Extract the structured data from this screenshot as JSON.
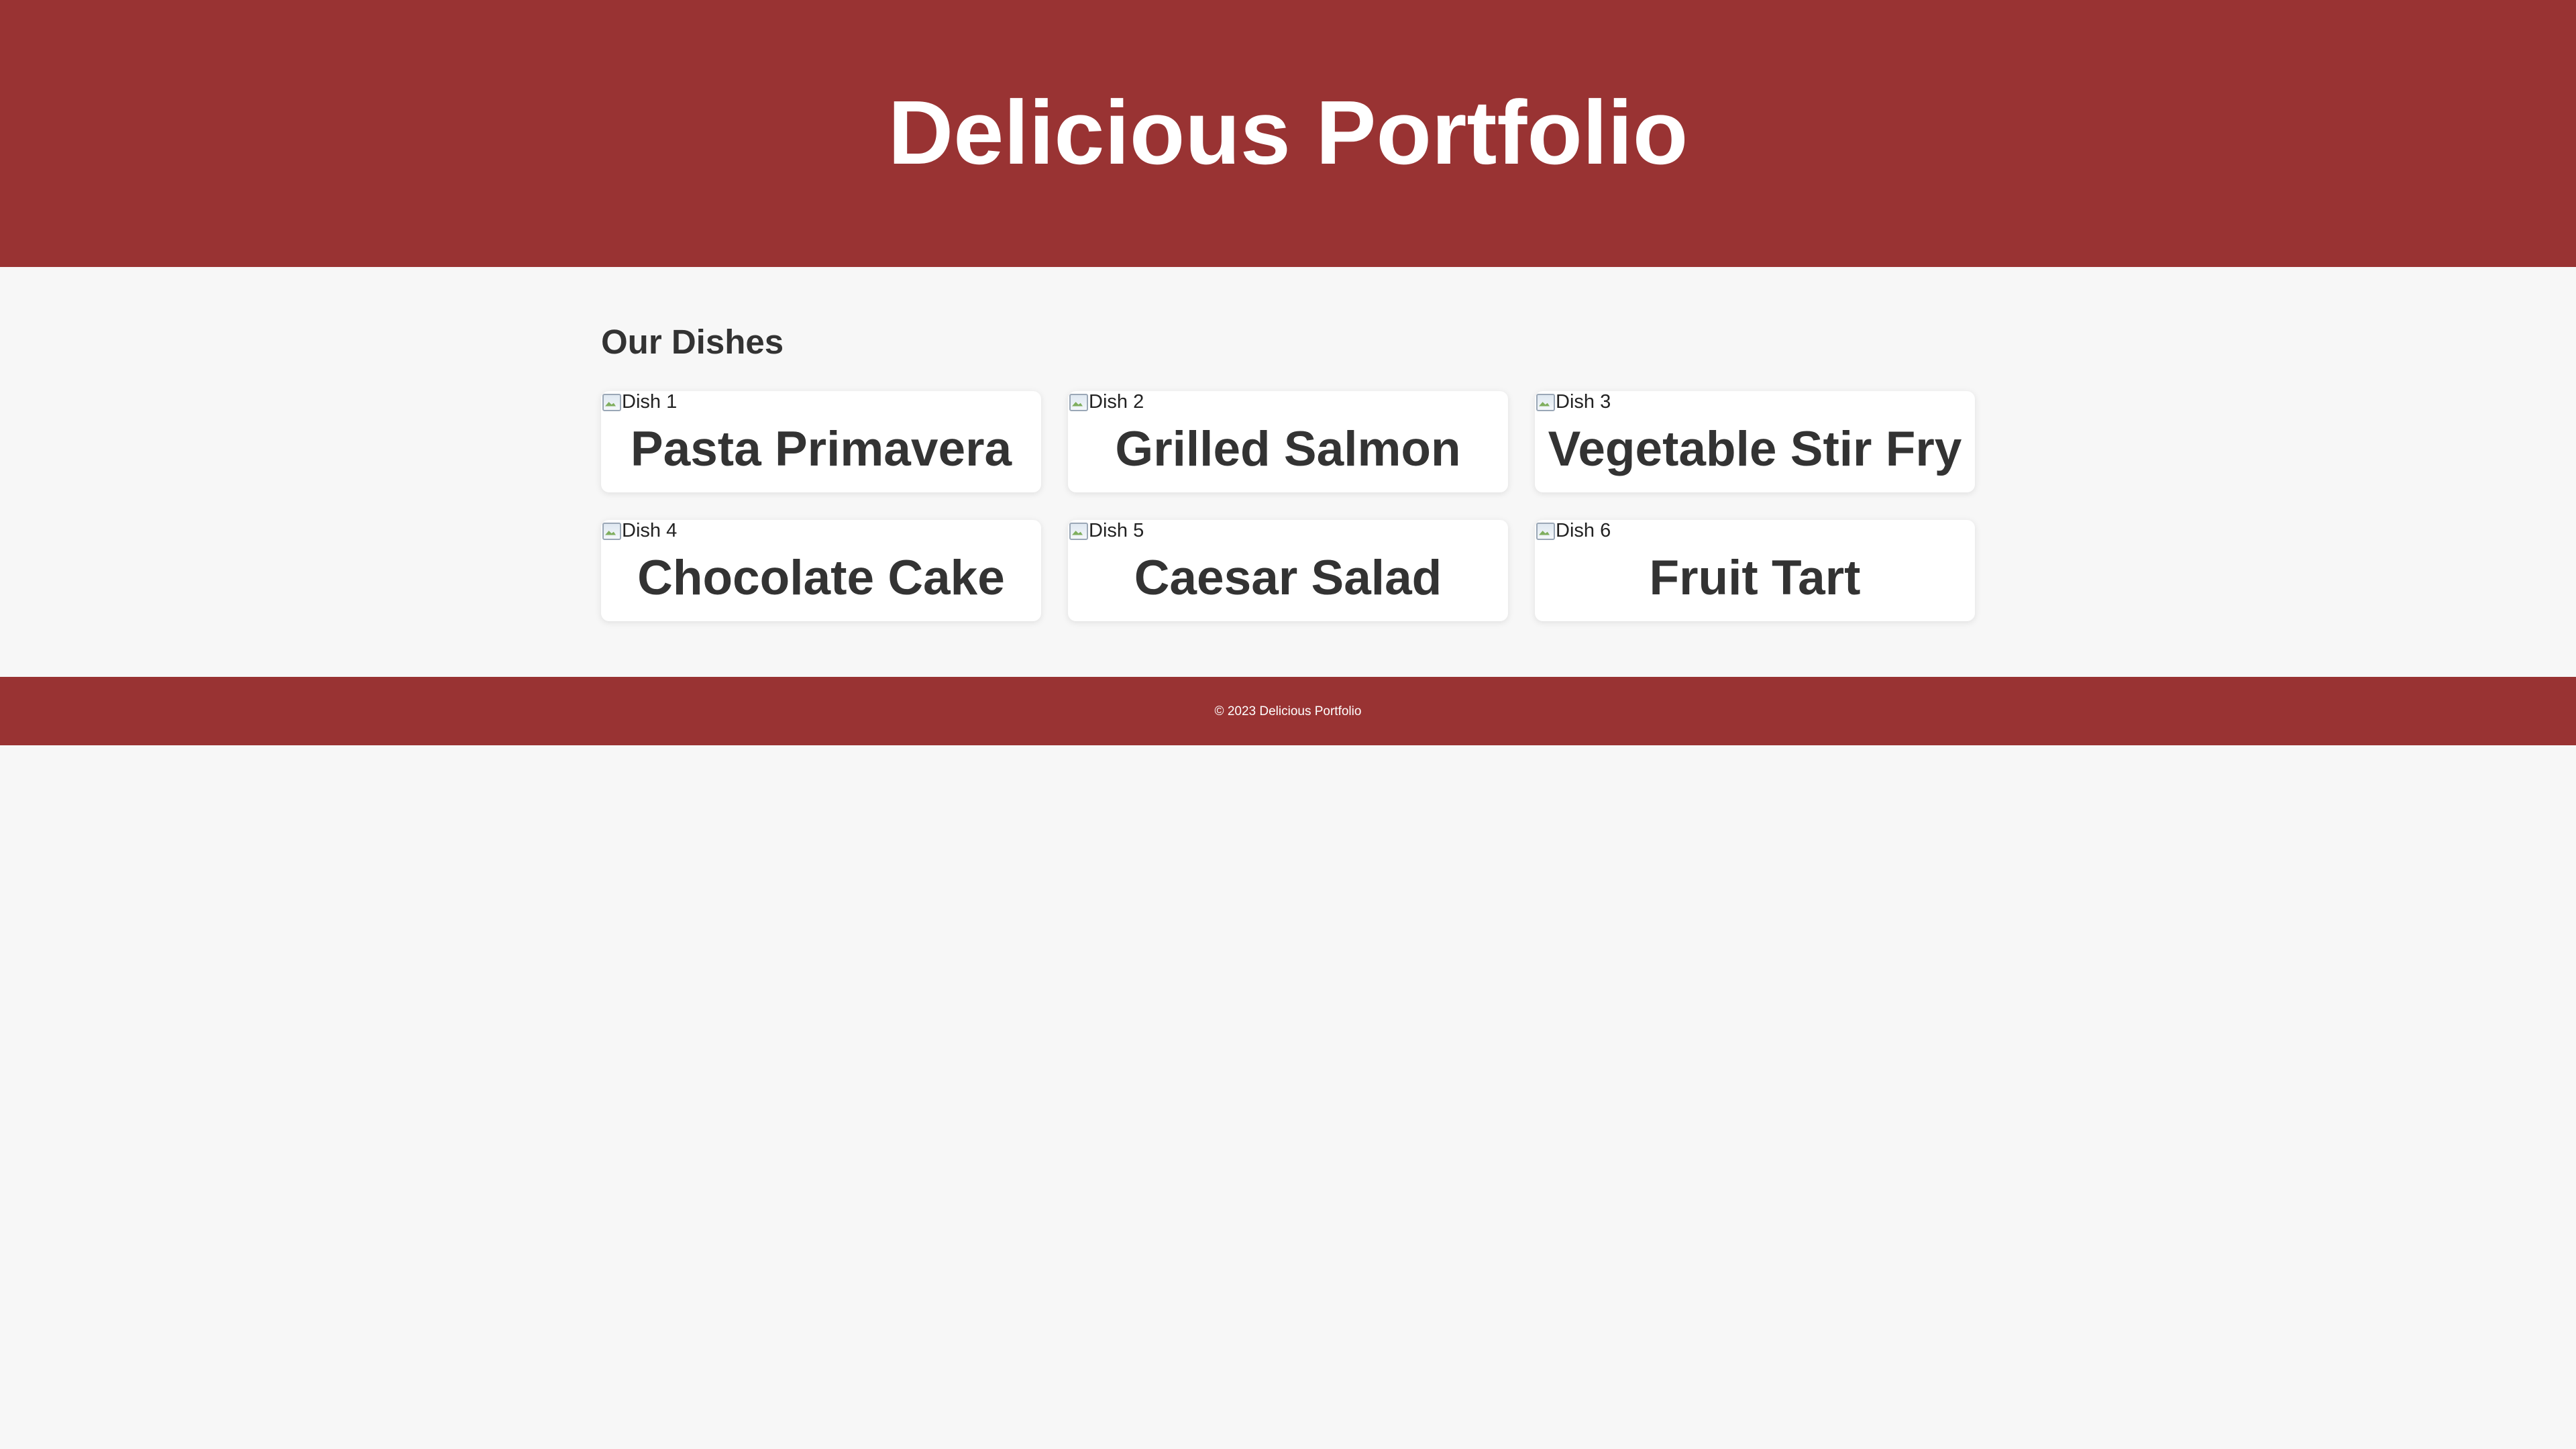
{
  "header": {
    "title": "Delicious Portfolio"
  },
  "main": {
    "section_title": "Our Dishes",
    "dishes": [
      {
        "image_alt": "Dish 1",
        "name": "Pasta Primavera"
      },
      {
        "image_alt": "Dish 2",
        "name": "Grilled Salmon"
      },
      {
        "image_alt": "Dish 3",
        "name": "Vegetable Stir Fry"
      },
      {
        "image_alt": "Dish 4",
        "name": "Chocolate Cake"
      },
      {
        "image_alt": "Dish 5",
        "name": "Caesar Salad"
      },
      {
        "image_alt": "Dish 6",
        "name": "Fruit Tart"
      }
    ]
  },
  "footer": {
    "text": "© 2023 Delicious Portfolio"
  },
  "colors": {
    "brand": "#993333",
    "background": "#f7f7f7",
    "card": "#ffffff",
    "text": "#333333"
  }
}
